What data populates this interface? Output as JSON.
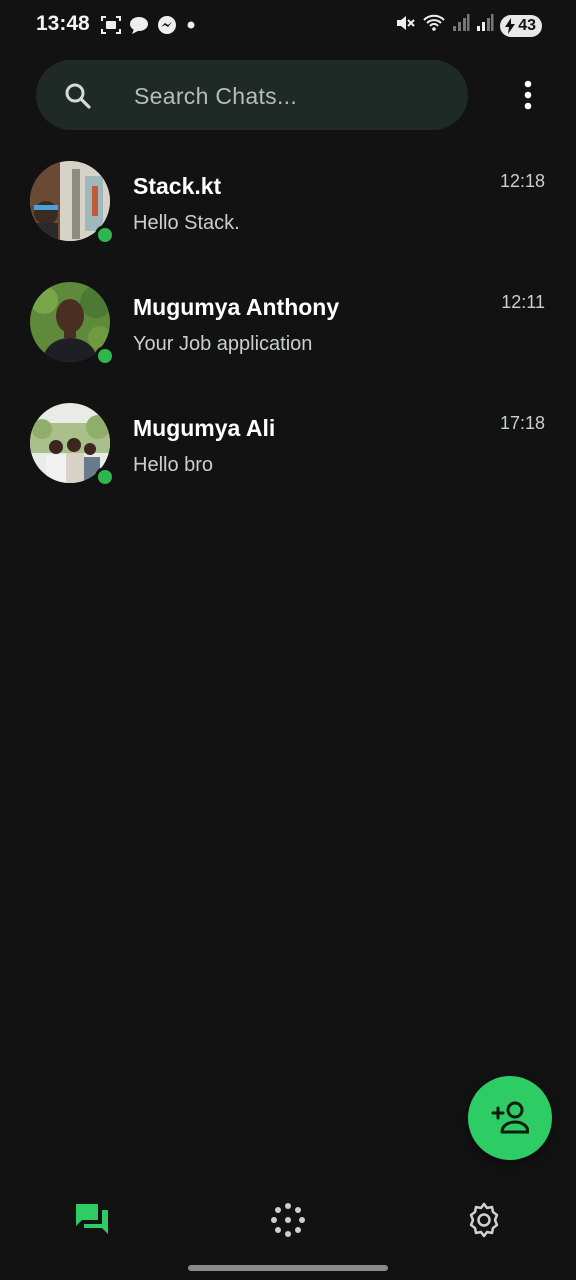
{
  "status_bar": {
    "time": "13:48",
    "left_icons": [
      "screenshot-icon",
      "chat-bubble-icon",
      "messenger-icon",
      "dot-icon"
    ],
    "right_icons": [
      "mute-icon",
      "wifi-icon",
      "signal-icon",
      "signal-icon-2"
    ],
    "battery": "43"
  },
  "search": {
    "placeholder": "Search Chats...",
    "value": ""
  },
  "chats": [
    {
      "name": "Stack.kt",
      "preview": "Hello Stack.",
      "time": "12:18",
      "online": true
    },
    {
      "name": "Mugumya Anthony",
      "preview": "Your Job application",
      "time": "12:11",
      "online": true
    },
    {
      "name": "Mugumya Ali",
      "preview": "Hello bro",
      "time": "17:18",
      "online": true
    }
  ],
  "fab": {
    "icon": "add-person-icon"
  },
  "bottom_nav": {
    "items": [
      {
        "icon": "chats-icon",
        "active": true
      },
      {
        "icon": "status-icon",
        "active": false
      },
      {
        "icon": "settings-icon",
        "active": false
      }
    ]
  },
  "colors": {
    "background": "#121212",
    "search_background": "#1f2a27",
    "accent": "#2ecc64",
    "online": "#2fb64f",
    "secondary_text": "#c9cfcc"
  }
}
